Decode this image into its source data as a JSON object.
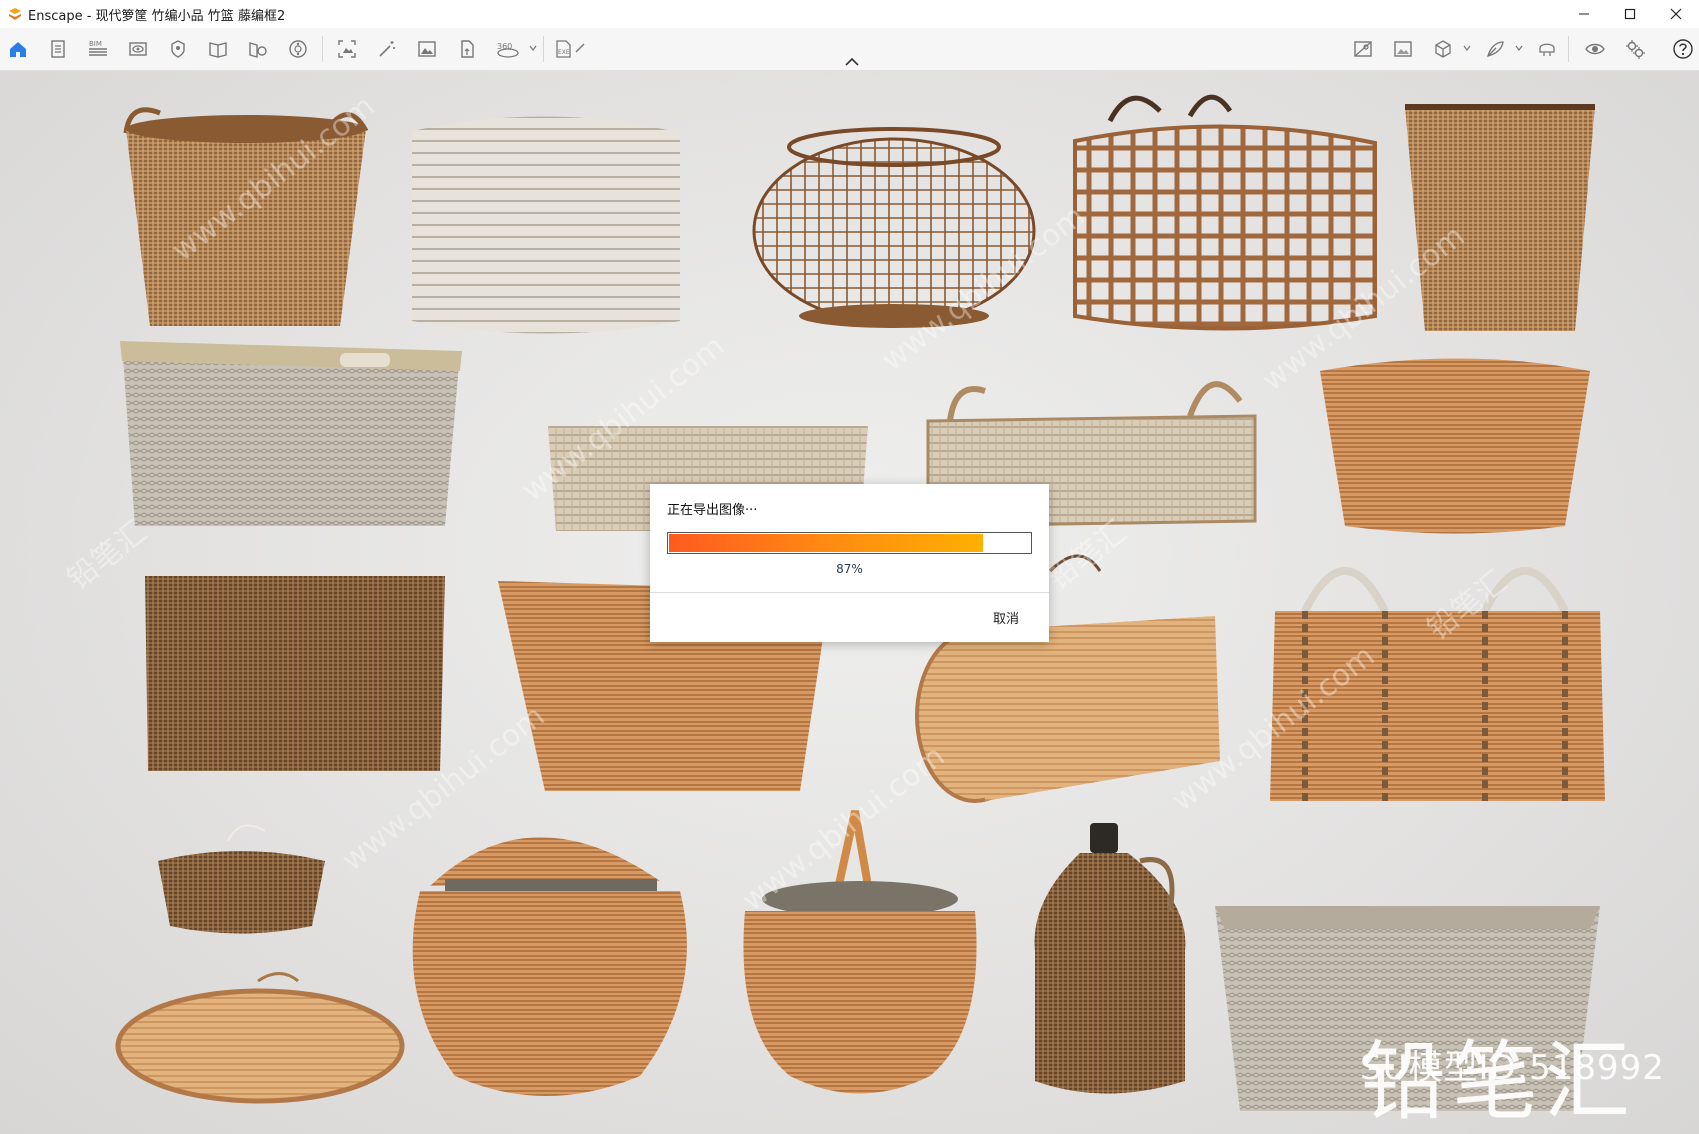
{
  "window": {
    "title": "Enscape - 现代箩筐 竹编小品 竹篮 藤编框2",
    "controls": [
      "minimize-icon",
      "maximize-icon",
      "close-icon"
    ]
  },
  "toolbar": {
    "left_icons": [
      "home-icon",
      "document-icon",
      "bim-icon",
      "eye-view-icon",
      "map-pin-icon",
      "book-icon",
      "book-settings-icon",
      "asset-library-icon",
      "capture-icon",
      "magic-wand-icon",
      "image-icon",
      "export-file-icon",
      "panorama-360-icon",
      "export-exe-icon"
    ],
    "right_icons": [
      "render-settings-icon",
      "image-settings-icon",
      "cube-view-icon",
      "feather-icon",
      "headset-vr-icon",
      "visibility-icon",
      "settings-gear-icon",
      "help-icon"
    ],
    "bim_label": "BIM",
    "pano_label": "360",
    "exe_label": "EXE"
  },
  "dialog": {
    "title": "正在导出图像···",
    "progress_percent": 87,
    "progress_text": "87%",
    "cancel_label": "取消"
  },
  "watermark": {
    "brand": "铅笔汇",
    "model_id": "SU模型ID:518992",
    "tile_a": "铅笔汇",
    "tile_b": "www.qbihui.com"
  },
  "colors": {
    "progress_start": "#ff5a1f",
    "progress_end": "#ffb000",
    "accent_blue": "#2b7de9",
    "rattan_light": "#c89a68",
    "rattan_dark": "#8a5a32",
    "rattan_gray": "#cfc8bb"
  }
}
